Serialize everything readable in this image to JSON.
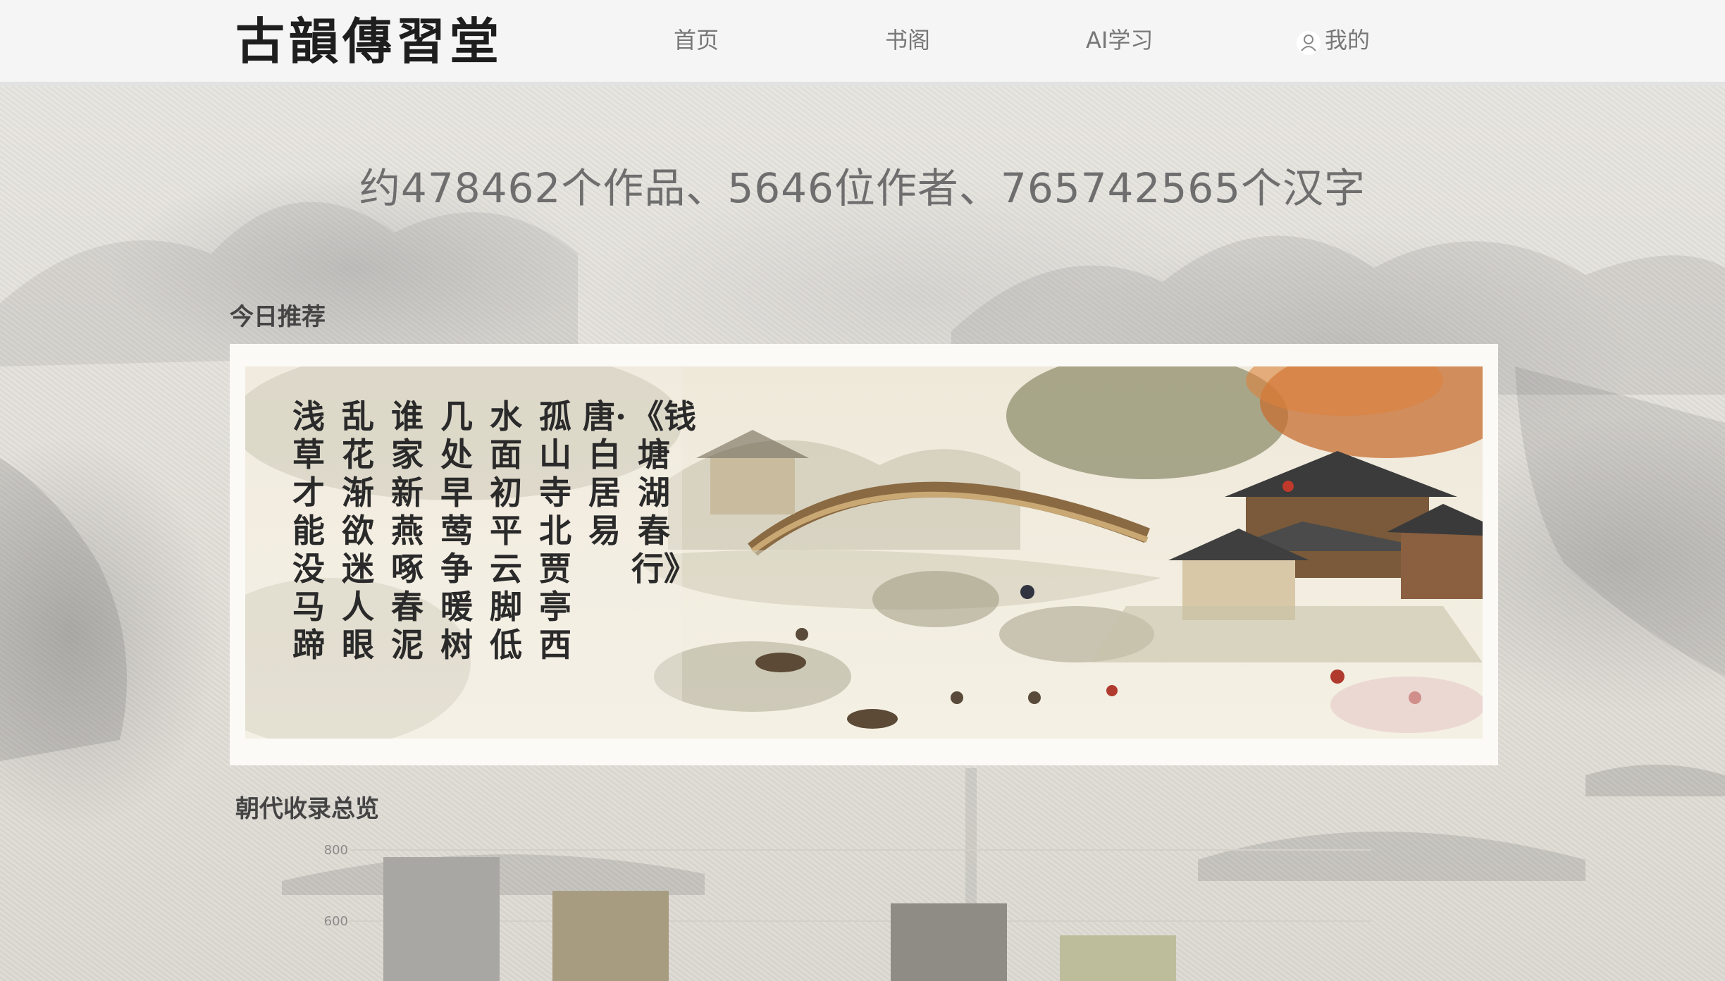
{
  "header": {
    "logo": "古韻傳習堂",
    "nav": [
      {
        "label": "首页"
      },
      {
        "label": "书阁"
      },
      {
        "label": "AI学习"
      },
      {
        "label": "我的",
        "icon": "user-icon"
      }
    ]
  },
  "stats": {
    "text": "约478462个作品、5646位作者、765742565个汉字"
  },
  "recommend": {
    "title": "今日推荐",
    "poem_columns": [
      "《钱塘湖春行》",
      "唐·白居易",
      "孤山寺北贾亭西",
      "水面初平云脚低",
      "几处早莺争暖树",
      "谁家新燕啄春泥",
      "乱花渐欲迷人眼",
      "浅草才能没马蹄"
    ]
  },
  "chart_section": {
    "title": "朝代收录总览"
  },
  "chart_data": {
    "type": "bar",
    "title": "",
    "xlabel": "",
    "ylabel": "",
    "yticks": [
      600,
      800
    ],
    "values": [
      780,
      685,
      null,
      650,
      560
    ],
    "colors": [
      "#a9a7a3",
      "#a89c80",
      null,
      "#8f8c85",
      "#bdbd9c"
    ]
  },
  "colors": {
    "header_bg": "#f5f5f5",
    "text_gray": "#6e6e6e",
    "nav_gray": "#777777"
  }
}
